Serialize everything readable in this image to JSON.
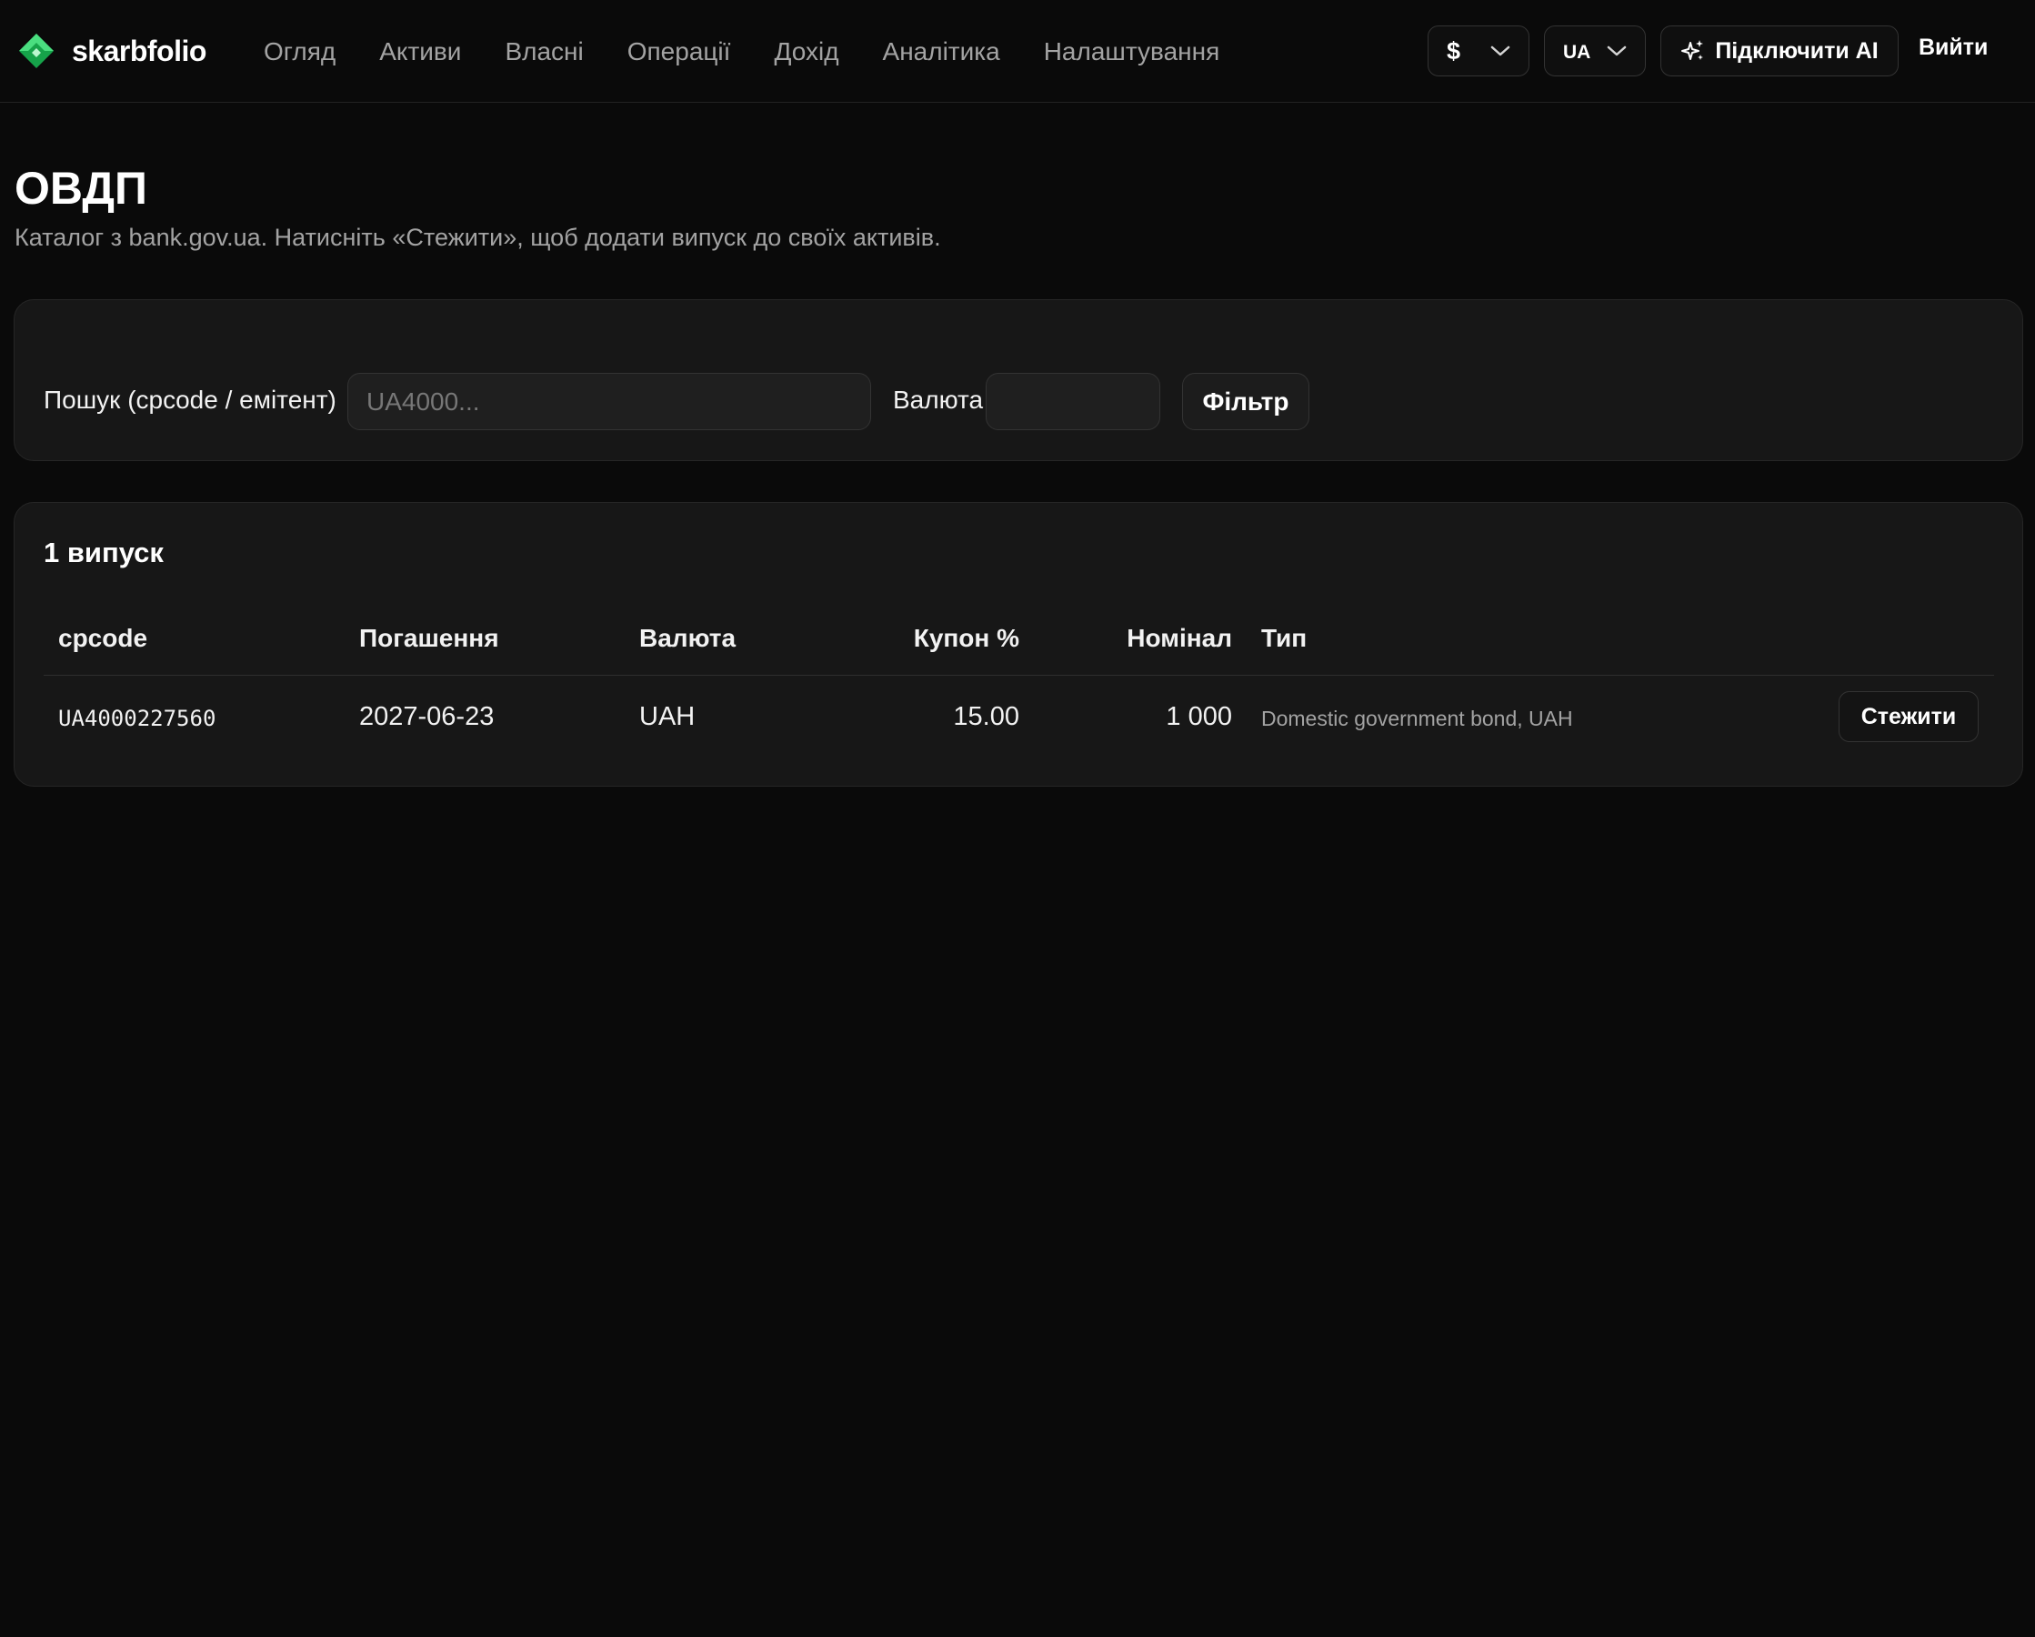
{
  "brand": {
    "name": "skarbfolio",
    "colors": {
      "logo_light": "#4ade80",
      "logo_dark": "#16a34a"
    }
  },
  "nav": {
    "items": [
      {
        "label": "Огляд"
      },
      {
        "label": "Активи"
      },
      {
        "label": "Власні"
      },
      {
        "label": "Операції"
      },
      {
        "label": "Дохід"
      },
      {
        "label": "Аналітика"
      },
      {
        "label": "Налаштування"
      }
    ]
  },
  "header": {
    "currency_selected": "$",
    "language_selected": "UA",
    "connect_ai_label": "Підключити AI",
    "logout_label": "Вийти"
  },
  "page": {
    "title": "ОВДП",
    "subtitle": "Каталог з bank.gov.ua. Натисніть «Стежити», щоб додати випуск до своїх активів."
  },
  "filter": {
    "search_label": "Пошук (cpcode / емітент)",
    "search_placeholder": "UA4000...",
    "search_value": "",
    "currency_label": "Валюта",
    "currency_value": "",
    "filter_button_label": "Фільтр"
  },
  "results": {
    "count_label": "1 випуск",
    "columns": {
      "cpcode": "cpcode",
      "maturity": "Погашення",
      "currency": "Валюта",
      "coupon": "Купон %",
      "nominal": "Номінал",
      "type": "Тип"
    },
    "rows": [
      {
        "cpcode": "UA4000227560",
        "maturity": "2027-06-23",
        "currency": "UAH",
        "coupon": "15.00",
        "nominal": "1 000",
        "type": "Domestic government bond, UAH",
        "action_label": "Стежити"
      }
    ]
  }
}
